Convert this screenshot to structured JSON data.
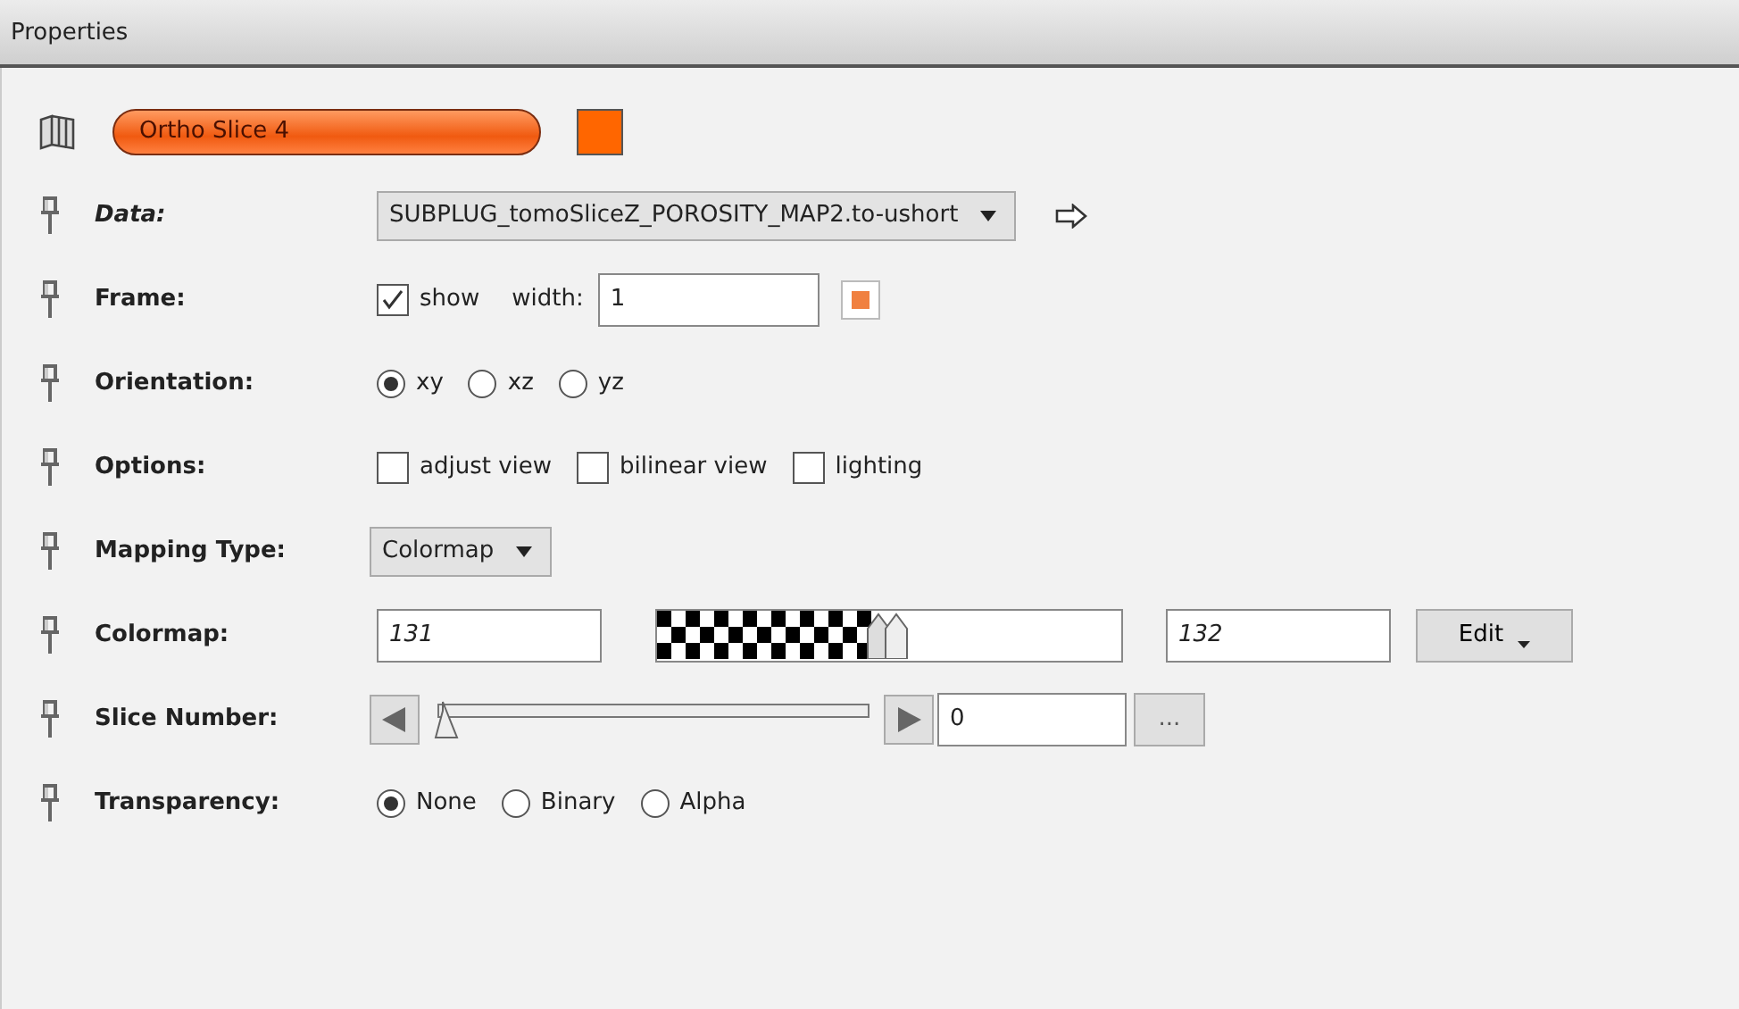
{
  "panel": {
    "title": "Properties"
  },
  "module": {
    "name": "Ortho Slice 4",
    "color": "#ff6600"
  },
  "rows": [
    {
      "kind": "dropdown-link",
      "label": "Data:",
      "italic": true,
      "value": "SUBPLUG_tomoSliceZ_POROSITY_MAP2.to-ushort"
    },
    {
      "kind": "frame",
      "label": "Frame:",
      "italic": false,
      "checkbox": {
        "label": "show",
        "checked": true
      },
      "field_label": "width:",
      "value": "1",
      "color": "#f08040"
    },
    {
      "kind": "radio",
      "label": "Orientation:",
      "italic": false,
      "options": [
        {
          "label": "xy",
          "selected": true
        },
        {
          "label": "xz",
          "selected": false
        },
        {
          "label": "yz",
          "selected": false
        }
      ]
    },
    {
      "kind": "checks",
      "label": "Options:",
      "italic": false,
      "options": [
        {
          "label": "adjust view",
          "checked": false
        },
        {
          "label": "bilinear view",
          "checked": false
        },
        {
          "label": "lighting",
          "checked": false
        }
      ]
    },
    {
      "kind": "dropdown",
      "label": "Mapping Type:",
      "italic": false,
      "value": "Colormap"
    },
    {
      "kind": "colormap",
      "label": "Colormap:",
      "italic": false,
      "min": "131",
      "max": "132",
      "button": "Edit"
    },
    {
      "kind": "slider",
      "label": "Slice Number:",
      "italic": false,
      "level": 0,
      "value": "0",
      "button": "..."
    },
    {
      "kind": "radio",
      "label": "Transparency:",
      "italic": false,
      "options": [
        {
          "label": "None",
          "selected": true
        },
        {
          "label": "Binary",
          "selected": false
        },
        {
          "label": "Alpha",
          "selected": false
        }
      ]
    }
  ]
}
